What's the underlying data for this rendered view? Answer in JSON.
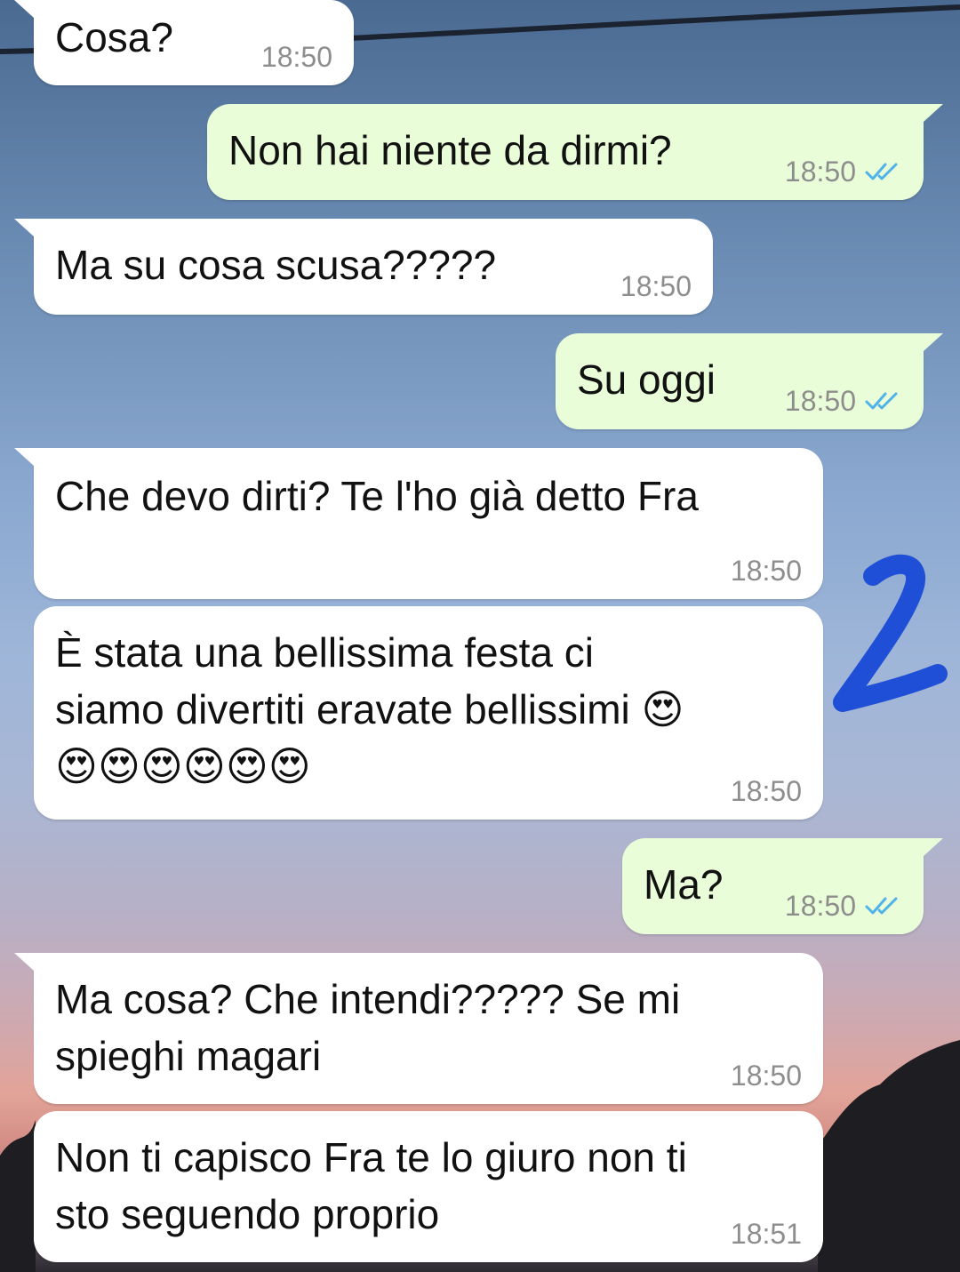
{
  "colors": {
    "incoming_bubble": "#ffffff",
    "outgoing_bubble": "#e9fdd8",
    "timestamp": "#8d8d8d",
    "read_ticks": "#4fb3ea",
    "annotation_ink": "#1f4fd6"
  },
  "messages": [
    {
      "direction": "in",
      "text": "Cosa?",
      "time": "18:50"
    },
    {
      "direction": "out",
      "text": "Non hai niente da dirmi?",
      "time": "18:50",
      "status_icon": "double-check-read"
    },
    {
      "direction": "in",
      "text": "Ma su cosa scusa?????",
      "time": "18:50"
    },
    {
      "direction": "out",
      "text": "Su oggi",
      "time": "18:50",
      "status_icon": "double-check-read"
    },
    {
      "direction": "in",
      "text": "Che devo dirti? Te l'ho già detto Fra",
      "time": "18:50"
    },
    {
      "direction": "in",
      "text": "È stata una bellissima festa ci\nsiamo divertiti eravate bellissimi 😍\n😍😍😍😍😍😍",
      "time": "18:50"
    },
    {
      "direction": "out",
      "text": "Ma?",
      "time": "18:50",
      "status_icon": "double-check-read"
    },
    {
      "direction": "in",
      "text": "Ma cosa? Che intendi????? Se mi\nspieghi magari",
      "time": "18:50"
    },
    {
      "direction": "in",
      "text": "Non ti capisco Fra te lo giuro non ti\nsto seguendo proprio",
      "time": "18:51"
    }
  ],
  "annotation": {
    "text": "2"
  }
}
